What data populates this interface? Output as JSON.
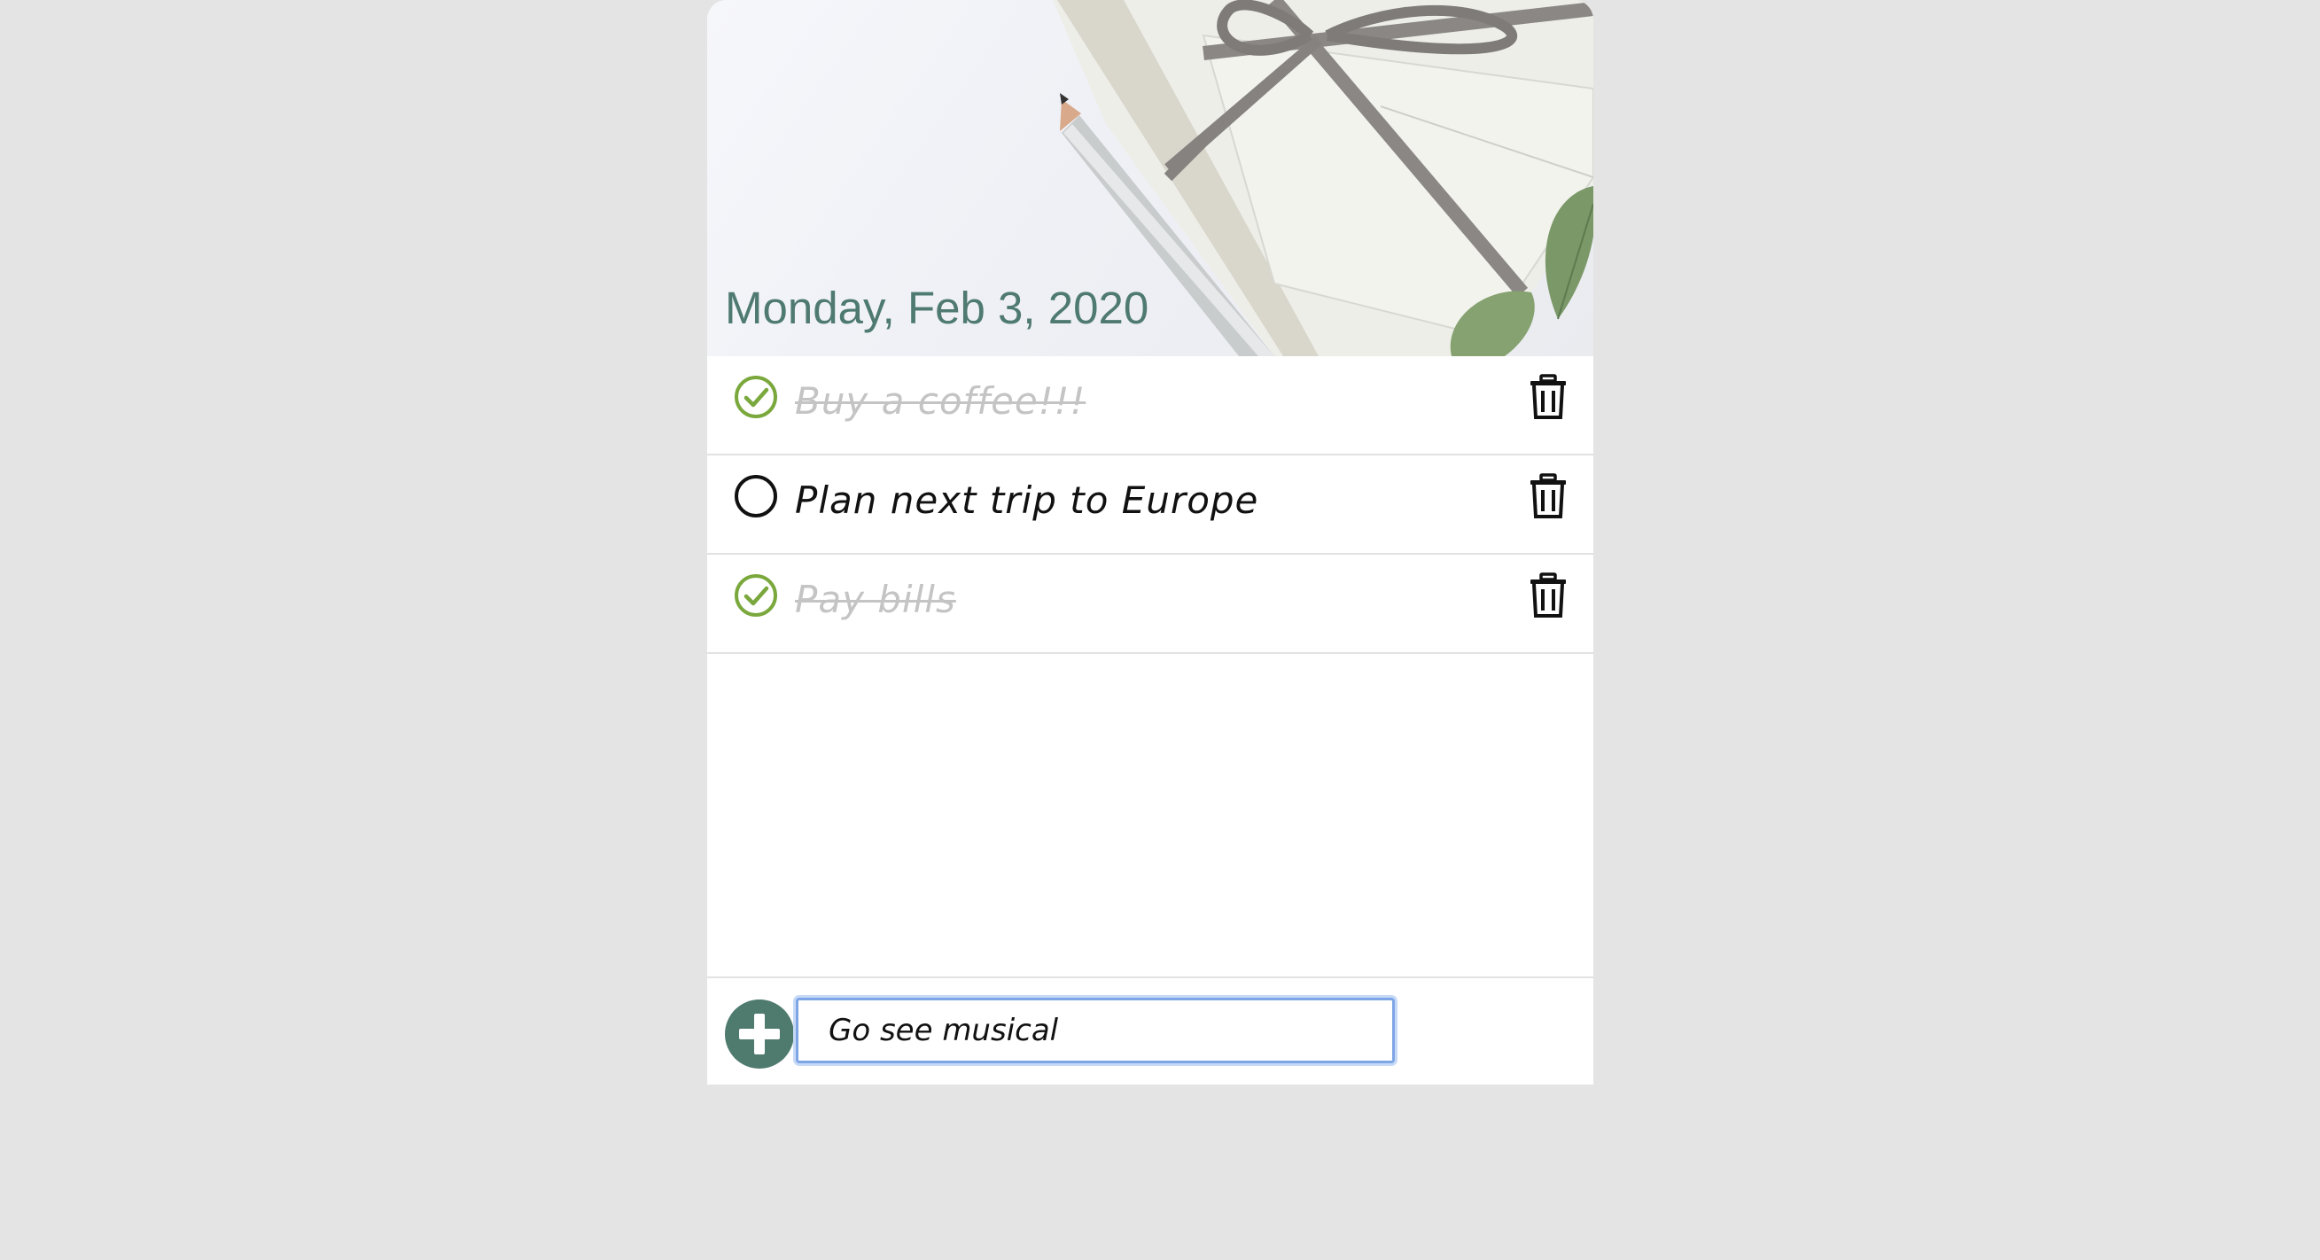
{
  "header": {
    "date": "Monday, Feb 3, 2020",
    "background_image": "gift-box-pencil-eucalyptus-photo"
  },
  "todos": [
    {
      "text": "Buy a coffee!!!",
      "done": true
    },
    {
      "text": "Plan next trip to Europe",
      "done": false
    },
    {
      "text": "Pay bills",
      "done": true
    }
  ],
  "footer": {
    "add_icon": "plus-icon",
    "input_value": "Go see musical"
  },
  "colors": {
    "page_bg": "#e4e4e4",
    "accent": "#4f7a6e",
    "check_done": "#7aa83c",
    "done_text": "#c4c4c4",
    "input_focus": "#7ea6e6"
  }
}
